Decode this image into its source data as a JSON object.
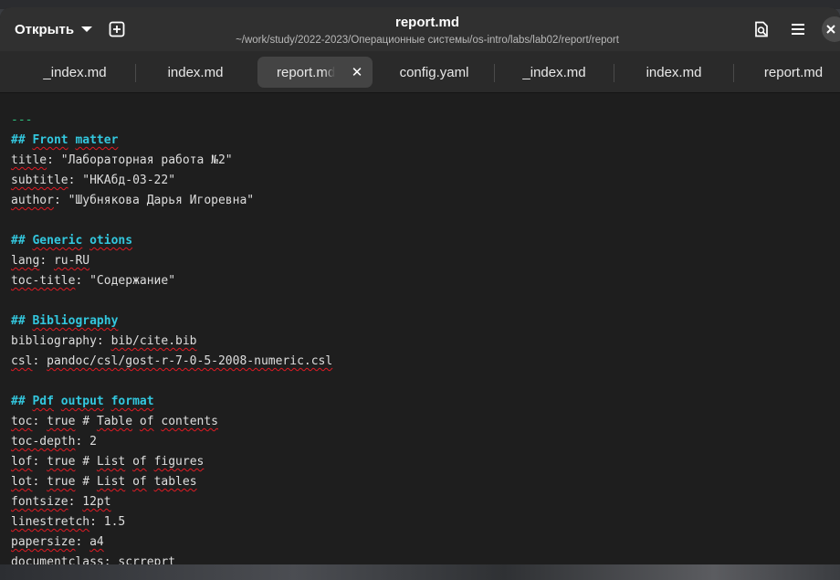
{
  "header": {
    "open_label": "Открыть",
    "title": "report.md",
    "subtitle": "~/work/study/2022-2023/Операционные системы/os-intro/labs/lab02/report/report",
    "icons": [
      "new-tab-icon",
      "search-document-icon",
      "menu-icon",
      "close-icon"
    ]
  },
  "tabs": [
    {
      "label": "_index.md",
      "active": false
    },
    {
      "label": "index.md",
      "active": false
    },
    {
      "label": "report.md",
      "active": true
    },
    {
      "label": "config.yaml",
      "active": false
    },
    {
      "label": "_index.md",
      "active": false
    },
    {
      "label": "index.md",
      "active": false
    },
    {
      "label": "report.md",
      "active": false
    }
  ],
  "editor": {
    "lines": [
      {
        "a": "---"
      },
      {
        "a": "## ",
        "b": "Front",
        "c": " ",
        "d": "matter"
      },
      {
        "a": "title",
        "b": ": \"Лабораторная работа №2\""
      },
      {
        "a": "subtitle",
        "b": ": \"НКАбд-03-22\""
      },
      {
        "a": "author",
        "b": ": \"Шубнякова Дарья Игоревна\""
      },
      {},
      {
        "a": "## ",
        "b": "Generic",
        "c": " ",
        "d": "otions"
      },
      {
        "a": "lang",
        "b": ": ",
        "c": "ru-RU"
      },
      {
        "a": "toc-title",
        "b": ": \"Содержание\""
      },
      {},
      {
        "a": "## ",
        "b": "Bibliography"
      },
      {
        "a": "bibliography",
        "b": ": ",
        "c": "bib/cite.bib"
      },
      {
        "a": "csl",
        "b": ": ",
        "c": "pandoc/csl/gost-r-7-0-5-2008-numeric.csl"
      },
      {},
      {
        "a": "## ",
        "b": "Pdf",
        "c": " ",
        "d": "output",
        "e": " ",
        "f": "format"
      },
      {
        "a": "toc",
        "b": ": ",
        "c": "true",
        "d": " # ",
        "e": "Table",
        "f": " ",
        "g": "of",
        "h": " ",
        "i": "contents"
      },
      {
        "a": "toc-depth",
        "b": ": 2"
      },
      {
        "a": "lof",
        "b": ": ",
        "c": "true",
        "d": " # ",
        "e": "List",
        "f": " ",
        "g": "of",
        "h": " ",
        "i": "figures"
      },
      {
        "a": "lot",
        "b": ": ",
        "c": "true",
        "d": " # ",
        "e": "List",
        "f": " ",
        "g": "of",
        "h": " ",
        "i": "tables"
      },
      {
        "a": "fontsize",
        "b": ": ",
        "c": "12pt"
      },
      {
        "a": "linestretch",
        "b": ": 1.5"
      },
      {
        "a": "papersize",
        "b": ": ",
        "c": "a4"
      },
      {
        "a": "documentclass",
        "b": ": ",
        "c": "scrreprt"
      }
    ]
  },
  "colors": {
    "accent_heading": "#33c7de",
    "hr": "#2ec27e",
    "spell_error": "#e01b24"
  }
}
